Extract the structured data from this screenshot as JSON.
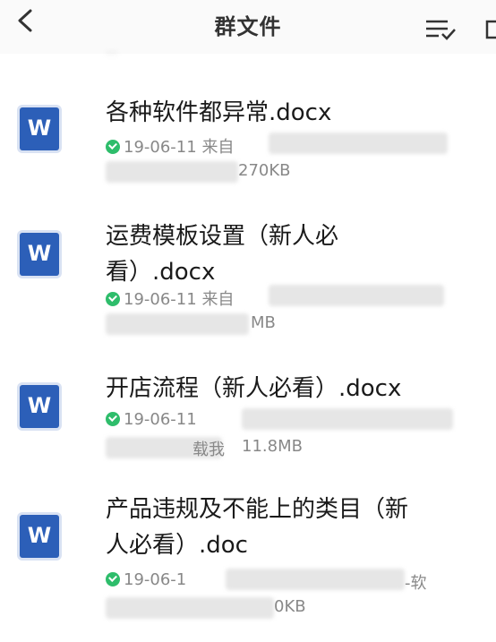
{
  "header": {
    "title": "群文件"
  },
  "subheader_text": "...",
  "files": [
    {
      "name_line1": "各种软件都异常.docx",
      "name_line2": "",
      "date": "19-06-11",
      "source": "来自",
      "size": "270KB",
      "icon": "W"
    },
    {
      "name_line1": "运费模板设置（新人必",
      "name_line2": "看）.docx",
      "date": "19-06-11",
      "source": "来自",
      "size": "MB",
      "icon": "W"
    },
    {
      "name_line1": "开店流程（新人必看）.docx",
      "name_line2": "",
      "date": "19-06-11",
      "source": "",
      "size": "11.8MB",
      "extra": "载我",
      "icon": "W"
    },
    {
      "name_line1": "产品违规及不能上的类目（新",
      "name_line2": "人必看）.doc",
      "date": "19-06-1",
      "source": "",
      "size": "0KB",
      "extra": "-软",
      "icon": "W"
    }
  ]
}
